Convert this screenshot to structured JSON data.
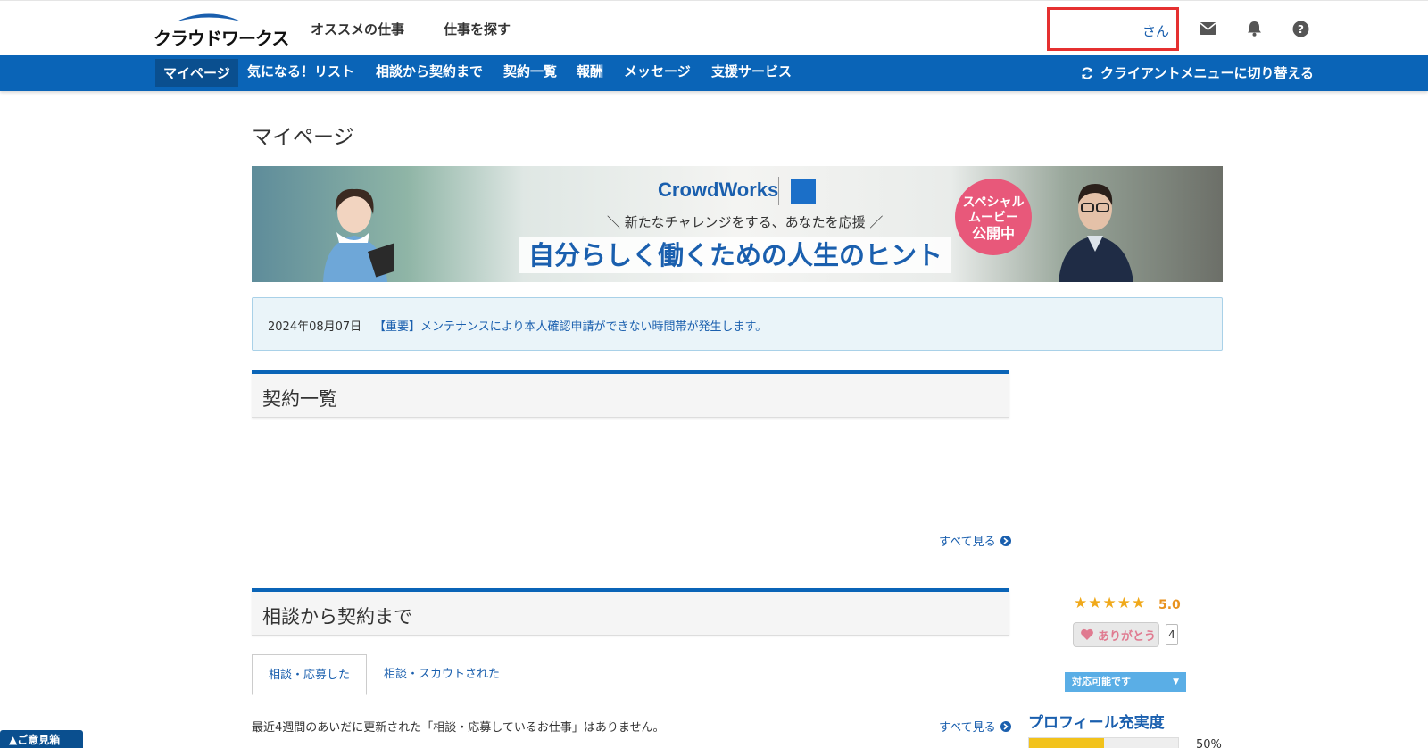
{
  "header": {
    "logo_text": "クラウドワークス",
    "nav": [
      "オススメの仕事",
      "仕事を探す"
    ],
    "user_label": "さん",
    "icons": [
      "mail-icon",
      "bell-icon",
      "help-icon"
    ]
  },
  "bluenav": {
    "items": [
      "マイページ",
      "気になる！リスト",
      "相談から契約まで",
      "契約一覧",
      "報酬",
      "メッセージ",
      "支援サービス"
    ],
    "active": "マイページ",
    "switch_label": "クライアントメニューに切り替える"
  },
  "page": {
    "title": "マイページ"
  },
  "banner": {
    "brand": "CrowdWorks",
    "subtitle": "＼ 新たなチャレンジをする、あなたを応援 ／",
    "headline": "自分らしく働くための人生のヒント",
    "badge_line1": "スペシャル",
    "badge_line2": "ムービー",
    "badge_line3": "公開中"
  },
  "notice": {
    "date": "2024年08月07日",
    "text": "【重要】メンテナンスにより本人確認申請ができない時間帯が発生します。"
  },
  "contracts": {
    "title": "契約一覧",
    "see_all": "すべて見る"
  },
  "consult": {
    "title": "相談から契約まで",
    "tabs": [
      "相談・応募した",
      "相談・スカウトされた"
    ],
    "active_tab": "相談・応募した",
    "empty_message": "最近4週間のあいだに更新された「相談・応募しているお仕事」はありません。",
    "see_all": "すべて見る"
  },
  "sidebar": {
    "stars": [
      "★",
      "★",
      "★",
      "★",
      "★"
    ],
    "rating": "5.0",
    "thanks_label": "ありがとう",
    "thanks_count": "4",
    "status": "対応可能です",
    "status_caret": "▼",
    "profile_title": "プロフィール充実度",
    "profile_percent": "50%",
    "profile_progress": 0.5
  },
  "feedback": {
    "label": "▲ご意見箱"
  },
  "colors": {
    "primary_blue": "#0a64b7",
    "link_blue": "#1a5fae",
    "highlight_red": "#e53030",
    "star_orange": "#f0a91b"
  }
}
